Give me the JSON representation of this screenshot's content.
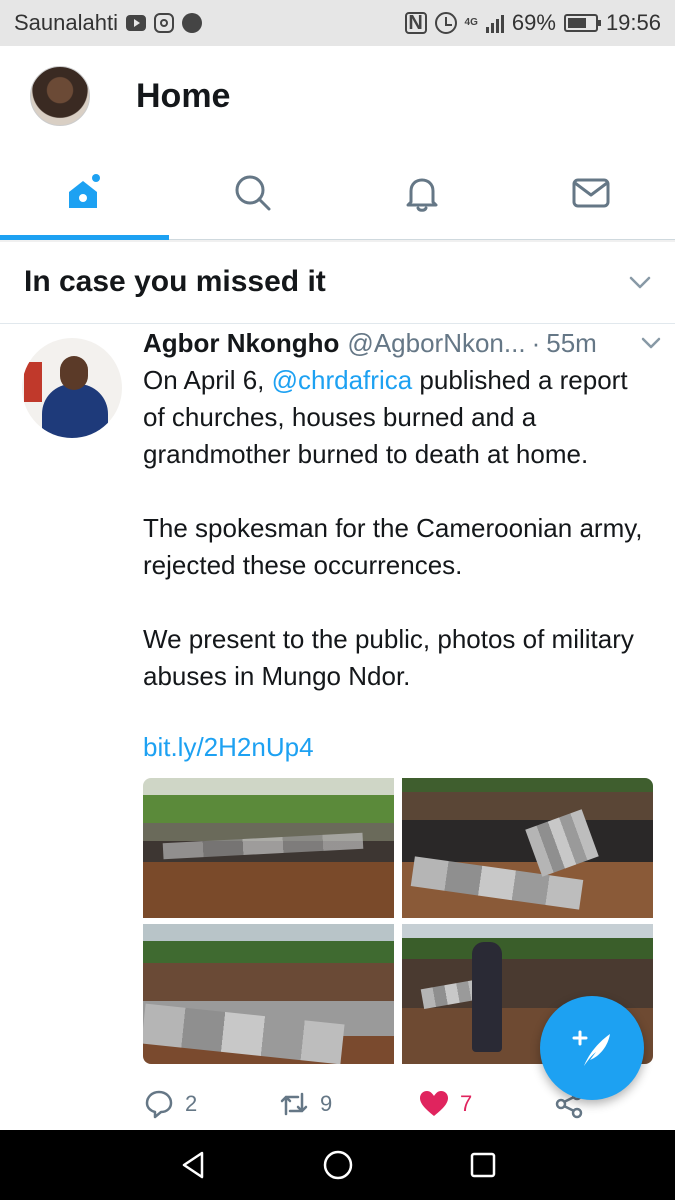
{
  "status_bar": {
    "carrier": "Saunalahti",
    "battery": "69%",
    "time": "19:56",
    "network": "4G"
  },
  "header": {
    "title": "Home"
  },
  "tabs": [
    {
      "name": "home",
      "icon": "home-icon",
      "active": true
    },
    {
      "name": "search",
      "icon": "search-icon",
      "active": false
    },
    {
      "name": "notifications",
      "icon": "bell-icon",
      "active": false
    },
    {
      "name": "messages",
      "icon": "mail-icon",
      "active": false
    }
  ],
  "section": {
    "title": "In case you missed it"
  },
  "tweet": {
    "author_name": "Agbor Nkongho",
    "handle": "@AgborNkon...",
    "separator": "·",
    "time": "55m",
    "text_p1_before": "On April 6, ",
    "mention": "@chrdafrica",
    "text_p1_after": " published a report of churches, houses burned and a grandmother burned to death at home.",
    "text_p2": "The spokesman for the Cameroonian army, rejected these occurrences.",
    "text_p3": "We present to the public, photos of military abuses in Mungo Ndor.",
    "link": "bit.ly/2H2nUp4",
    "replies": "2",
    "retweets": "9",
    "likes": "7"
  },
  "colors": {
    "accent": "#1da1f2",
    "like": "#e0245e",
    "secondary_text": "#657786"
  }
}
